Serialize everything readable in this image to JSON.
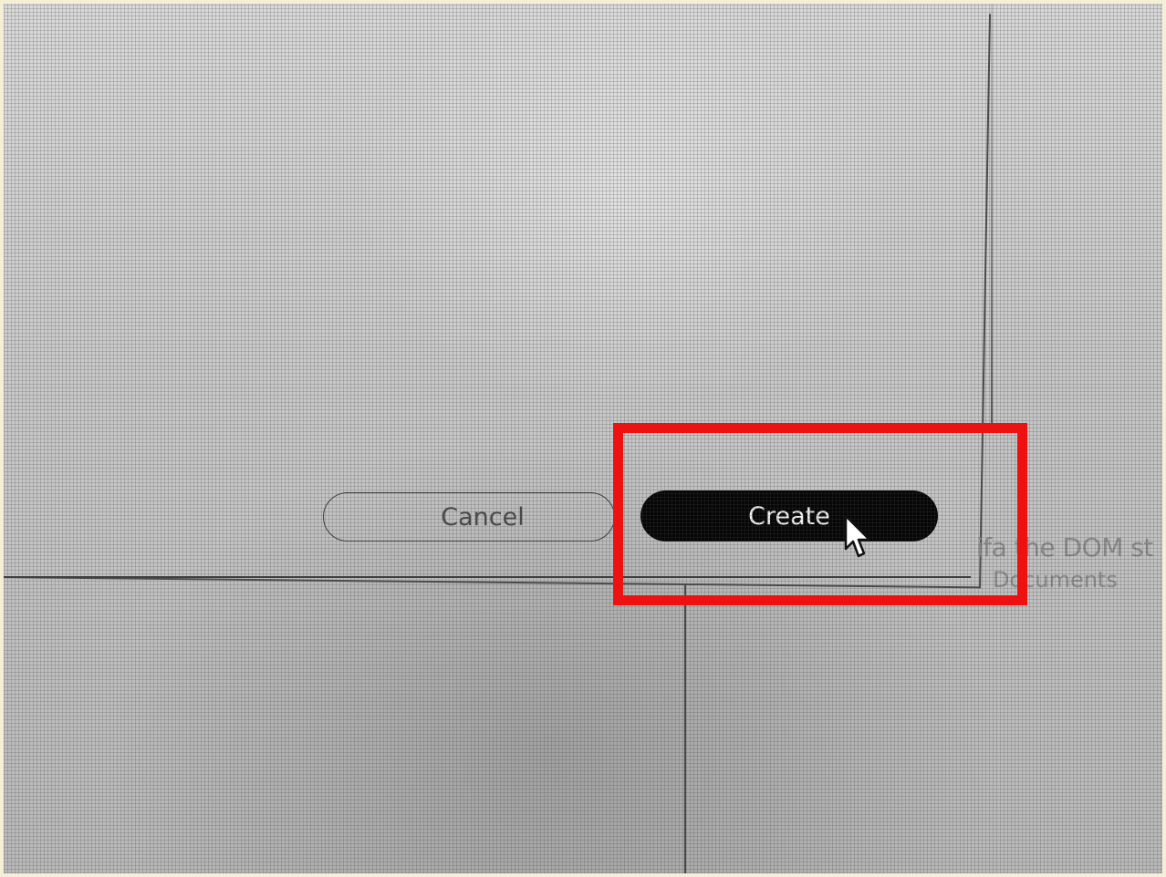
{
  "dialog": {
    "cancel_label": "Cancel",
    "create_label": "Create"
  },
  "background_text": {
    "line1": "ifa the DOM st",
    "line2": "Documents"
  },
  "highlight": {
    "color": "#ee1111",
    "target": "create-button"
  },
  "cursor": {
    "icon": "arrow-pointer-icon"
  }
}
